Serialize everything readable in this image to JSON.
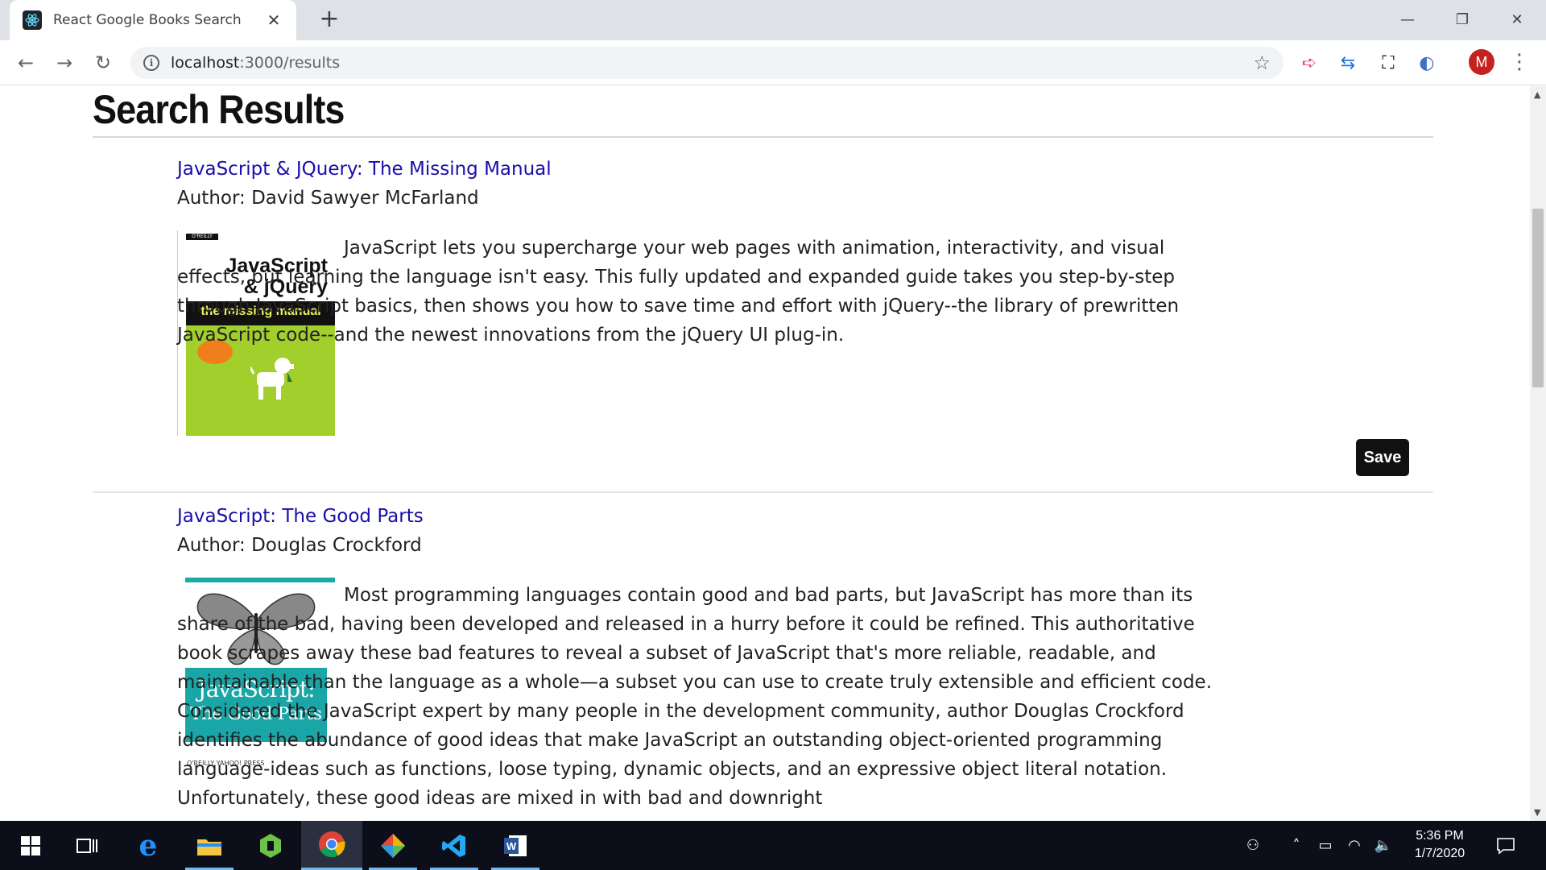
{
  "browser": {
    "tab_title": "React Google Books Search",
    "url_host": "localhost",
    "url_path": ":3000/results",
    "avatar_letter": "M"
  },
  "page": {
    "heading": "Search Results",
    "save_label": "Save",
    "books": [
      {
        "title": "JavaScript & JQuery: The Missing Manual",
        "author": "Author: David Sawyer McFarland",
        "description": "JavaScript lets you supercharge your web pages with animation, interactivity, and visual effects, but learning the language isn't easy. This fully updated and expanded guide takes you step-by-step through JavaScript basics, then shows you how to save time and effort with jQuery--the library of prewritten JavaScript code--and the newest innovations from the jQuery UI plug-in.",
        "cover": {
          "publisher": "O'REILLY",
          "line1": "JavaScript",
          "line2": "& jQuery",
          "band": "the missing manual"
        }
      },
      {
        "title": "JavaScript: The Good Parts",
        "author": "Author: Douglas Crockford",
        "description": "Most programming languages contain good and bad parts, but JavaScript has more than its share of the bad, having been developed and released in a hurry before it could be refined. This authoritative book scrapes away these bad features to reveal a subset of JavaScript that's more reliable, readable, and maintainable than the language as a whole—a subset you can use to create truly extensible and efficient code. Considered the JavaScript expert by many people in the development community, author Douglas Crockford identifies the abundance of good ideas that make JavaScript an outstanding object-oriented programming language-ideas such as functions, loose typing, dynamic objects, and an expressive object literal notation. Unfortunately, these good ideas are mixed in with bad and downright",
        "cover": {
          "line1": "JavaScript:",
          "line2": "The Good Parts",
          "footer": "O'REILLY  YAHOO! PRESS"
        }
      }
    ]
  },
  "taskbar": {
    "time": "5:36 PM",
    "date": "1/7/2020",
    "icons": [
      "windows-start-icon",
      "task-view-icon",
      "edge-icon",
      "file-explorer-icon",
      "node-icon",
      "chrome-icon",
      "sourcetree-icon",
      "vscode-icon",
      "word-icon"
    ]
  },
  "colors": {
    "link": "#1a0dab",
    "save_button": "#111111",
    "taskbar": "#0c0f1a"
  }
}
